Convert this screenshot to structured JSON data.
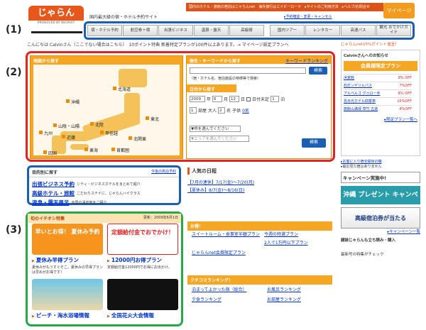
{
  "header": {
    "logo_text": "じゃらん",
    "logo_sub": "PRODUCED BY RECRUIT",
    "top_links": "国内のホテル・旅館の宿泊はじゃらんnet　海外旅行はエイビーロード　▸サイトのご利用方法　▸ヘルプ/お問合せ",
    "mypage_label": "マイページ",
    "tagline": "国内最大級の宿・ホテル予約サイト",
    "sub_links": "▸予約確認・変更・キャンセル"
  },
  "nav": {
    "items": [
      "宿・ホテル予約",
      "航空券＋宿",
      "出張ビジネス",
      "温泉・露天",
      "高級宿",
      "国内ツアー",
      "レンタカー",
      "高速バス",
      "観光 おでかけガイド"
    ]
  },
  "callouts": {
    "c1": "(1)",
    "c2": "(2)",
    "c3": "(3)"
  },
  "greeting": "こんにちは Calvinさん（ここでない場合はこちら）　10ポイント特典 新着特定プランが100件以上あります。→ マイページ設定プランへ",
  "map": {
    "header": "地図から探す",
    "regions": [
      "北海道",
      "沖縄",
      "東北",
      "山陰・山陽",
      "北陸",
      "甲信越",
      "九州",
      "近畿",
      "北関東",
      "四国",
      "東海",
      "首都圏"
    ]
  },
  "search": {
    "keyword_header": "宿名・キーワードから探す",
    "keyword_ranking": "キーワードランキング",
    "keyword_hint": "（宿・ホテル名、宿泊施設の特徴等で検索）",
    "search_btn": "検索",
    "date_header": "日付から探す",
    "year": "2009",
    "year_unit": "年",
    "month": "6",
    "month_unit": "月",
    "day": "12",
    "day_unit": "日",
    "undecided": "日付未定",
    "nights": "1",
    "nights_unit": "泊",
    "rooms": "1",
    "rooms_unit": "部屋",
    "adults_label": "大人",
    "adults": "2",
    "adults_unit": "名",
    "child_label": "子供",
    "child": "0名",
    "pref_placeholder": "▼県を選んでください",
    "area_placeholder": "▼エリアを選んでください",
    "search_btn2": "検索"
  },
  "purpose": {
    "header": "目的別に探す",
    "header_link": "今後の高泊予約",
    "items": [
      {
        "label": "出張ビジネス予約",
        "desc": "シティ・ビジネスホテルをまとめて紹介"
      },
      {
        "label": "高級ホテル・旅館",
        "desc": "こだわりステイに、じゃらんハイクラス"
      },
      {
        "label": "温泉・露天風呂",
        "desc": "全国の温泉地をご紹介"
      }
    ]
  },
  "popular": {
    "header": "人気の日程",
    "items": [
      "【7月の連休】7/17(金)〜7/20(月)",
      "【夏休み】8/7(金)〜8/16(日)"
    ]
  },
  "features": {
    "header": "旬のイチオシ特集",
    "updated": "更新：2009年6月1日",
    "items": [
      {
        "banner": "早いとお得！ 夏休み予約",
        "title": "夏休み早得プラン",
        "desc": "夏休みがもうすぐそこ。夏休みの早得プランは早めがお得です！"
      },
      {
        "banner": "定額給付金でおでかけ！",
        "title": "12000円お得プラン",
        "desc": "定額給付金12000円でお得にお出かけ。"
      },
      {
        "banner": "",
        "title": "ビーチ・海水浴場情報",
        "desc": ""
      },
      {
        "banner": "",
        "title": "全国花火大会情報",
        "desc": ""
      }
    ]
  },
  "deals": {
    "header": "お得！",
    "items": [
      "スイートルーム・食事室半額プラン",
      "今週の特選プラン",
      "じゃらんnet会員限定プラン",
      "2人で1万円以下プラン"
    ]
  },
  "ranking": {
    "header": "クチコミランキング！",
    "items": [
      "泊まってよかった宿（総合）",
      "お風呂ランキング",
      "夕食ランキング",
      "お部屋ランキング"
    ]
  },
  "sidebar": {
    "points_text": "じゃらんnet15%ポイント進呈！",
    "user_news": "Calvinさんへのお知らせ",
    "member_plan": "会員様限定プラン",
    "deals": [
      {
        "name": "浜家館",
        "val": "8% OFF"
      },
      {
        "name": "石灯ンゲリルパス",
        "val": "7%OFF"
      },
      {
        "name": "アルベルゴ グゥロー手",
        "val": "6% OFF"
      },
      {
        "name": "島日光ホテル四季亭",
        "val": "15%OFF"
      },
      {
        "name": "旅館山満禄 草竹 古道",
        "val": "4%OFF"
      }
    ],
    "limited": "▸限定プラン一覧へ",
    "links": [
      "▸お客に入り宿全録目の棚",
      "▸最近見た宿はありません"
    ],
    "campaign": "キャンペーン実施中!",
    "okinawa": "沖縄 プレゼント キャンペーン",
    "yado": "高級宿泊券が当たる",
    "campaign_more": "▸キャンペーン一覧",
    "magazine": "雑誌じゃらんも立ち読み・購入",
    "magazine_sub": "最新号の特集がチェック"
  }
}
